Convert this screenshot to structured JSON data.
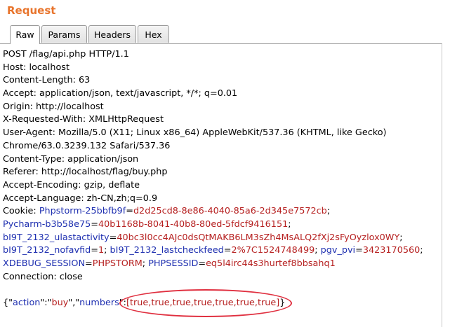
{
  "panel": {
    "title": "Request"
  },
  "tabs": [
    {
      "label": "Raw",
      "active": true
    },
    {
      "label": "Params",
      "active": false
    },
    {
      "label": "Headers",
      "active": false
    },
    {
      "label": "Hex",
      "active": false
    }
  ],
  "request": {
    "lines": [
      "POST /flag/api.php HTTP/1.1",
      "Host: localhost",
      "Content-Length: 63",
      "Accept: application/json, text/javascript, */*; q=0.01",
      "Origin: http://localhost",
      "X-Requested-With: XMLHttpRequest",
      "User-Agent: Mozilla/5.0 (X11; Linux x86_64) AppleWebKit/537.36 (KHTML, like Gecko)",
      "Chrome/63.0.3239.132 Safari/537.36",
      "Content-Type: application/json",
      "Referer: http://localhost/flag/buy.php",
      "Accept-Encoding: gzip, deflate",
      "Accept-Language: zh-CN,zh;q=0.9"
    ],
    "cookie_label": "Cookie: ",
    "cookies": {
      "c1_key": "Phpstorm-25bbfb9f",
      "c1_val": "d2d25cd8-8e86-4040-85a6-2d345e7572cb",
      "c2_key": "Pycharm-b3b58e75",
      "c2_val": "40b1168b-8041-40b8-80ed-5fdcf9416151",
      "c3_key": "bI9T_2132_ulastactivity",
      "c3_val": "40bc3l0cc4AJc0dsQtMAKB6LM3sZh4MsALQ2fXj2sFyOyzlox0WY",
      "c4_key": "bI9T_2132_nofavfid",
      "c4_val": "1",
      "c5_key": "bI9T_2132_lastcheckfeed",
      "c5_val": "2%7C1524748499",
      "c6_key": "pgv_pvi",
      "c6_val": "3423170560",
      "c7_key": "XDEBUG_SESSION",
      "c7_val": "PHPSTORM",
      "c8_key": "PHPSESSID",
      "c8_val": "eq5l4irc44s3hurtef8bbsahq1"
    },
    "connection": "Connection: close",
    "body": {
      "open": "{\"",
      "k1": "action",
      "sep1": "\":\"",
      "v1": "buy",
      "sep2": "\",\"",
      "k2": "numbers",
      "sep3": "\":",
      "v2": "[true,true,true,true,true,true,true]",
      "close": "}"
    }
  },
  "colors": {
    "title": "#e8742c",
    "key": "#1e2fb0",
    "value": "#b62020",
    "highlight": "#e03040"
  }
}
